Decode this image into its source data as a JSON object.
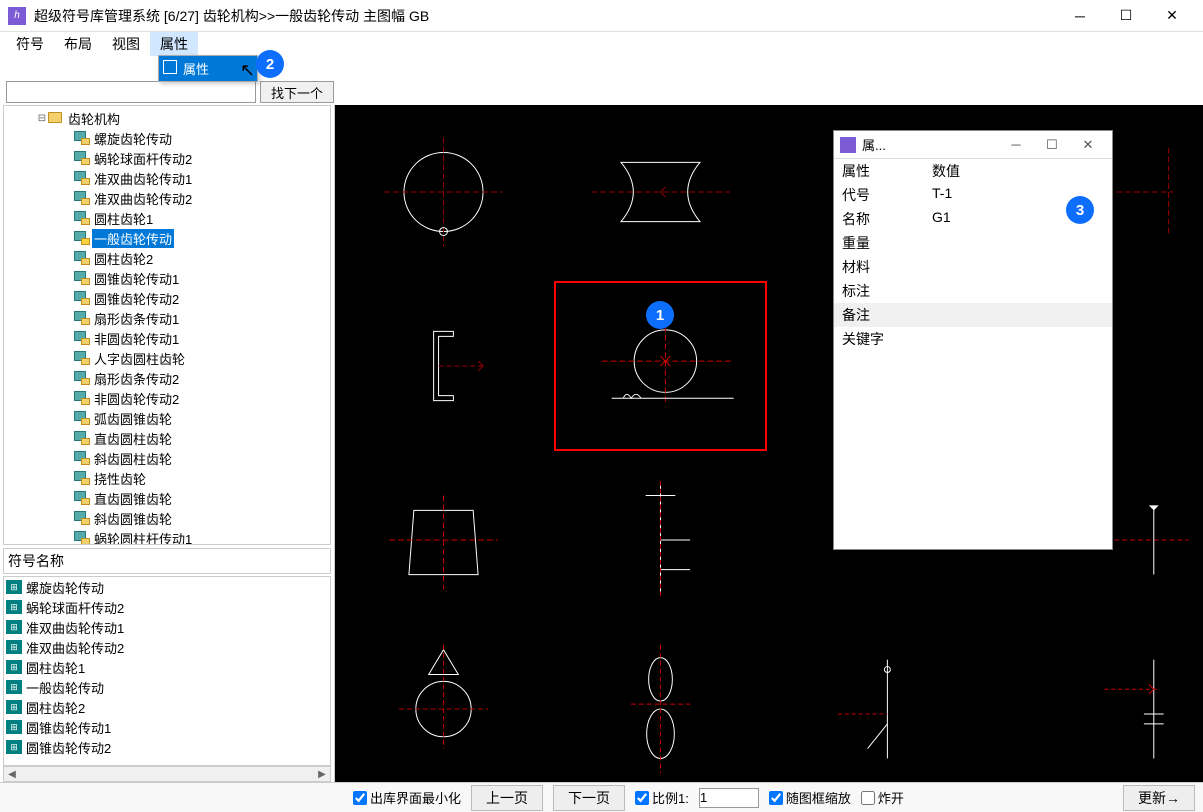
{
  "titlebar": {
    "app_name": "超级符号库管理系统",
    "counter": "[6/27]",
    "breadcrumb": "齿轮机构>>一般齿轮传动 主图幅 GB"
  },
  "menu": {
    "items": [
      "符号",
      "布局",
      "视图",
      "属性"
    ],
    "open_index": 3,
    "dropdown": {
      "label": "属性"
    }
  },
  "searchbar": {
    "placeholder": "",
    "find_next": "找下一个"
  },
  "tree": {
    "root": "齿轮机构",
    "selected": "一般齿轮传动",
    "children": [
      "螺旋齿轮传动",
      "蜗轮球面杆传动2",
      "准双曲齿轮传动1",
      "准双曲齿轮传动2",
      "圆柱齿轮1",
      "一般齿轮传动",
      "圆柱齿轮2",
      "圆锥齿轮传动1",
      "圆锥齿轮传动2",
      "扇形齿条传动1",
      "非圆齿轮传动1",
      "人字齿圆柱齿轮",
      "扇形齿条传动2",
      "非圆齿轮传动2",
      "弧齿圆锥齿轮",
      "直齿圆柱齿轮",
      "斜齿圆柱齿轮",
      "挠性齿轮",
      "直齿圆锥齿轮",
      "斜齿圆锥齿轮",
      "蜗轮圆柱杆传动1"
    ]
  },
  "symlist": {
    "header": "符号名称",
    "items": [
      "螺旋齿轮传动",
      "蜗轮球面杆传动2",
      "准双曲齿轮传动1",
      "准双曲齿轮传动2",
      "圆柱齿轮1",
      "一般齿轮传动",
      "圆柱齿轮2",
      "圆锥齿轮传动1",
      "圆锥齿轮传动2"
    ]
  },
  "propwin": {
    "title": "属...",
    "header_key": "属性",
    "header_val": "数值",
    "rows": [
      {
        "k": "代号",
        "v": "T-1"
      },
      {
        "k": "名称",
        "v": "G1"
      },
      {
        "k": "重量",
        "v": ""
      },
      {
        "k": "材料",
        "v": ""
      },
      {
        "k": "标注",
        "v": ""
      },
      {
        "k": "备注",
        "v": ""
      },
      {
        "k": "关键字",
        "v": ""
      }
    ]
  },
  "footer": {
    "minimize_on_out": "出库界面最小化",
    "prev": "上一页",
    "next": "下一页",
    "scale_label": "比例1:",
    "scale_value": "1",
    "zoom_with_frame": "随图框缩放",
    "explode": "炸开",
    "refresh": "更新→"
  },
  "badges": {
    "b1": "1",
    "b2": "2",
    "b3": "3"
  }
}
